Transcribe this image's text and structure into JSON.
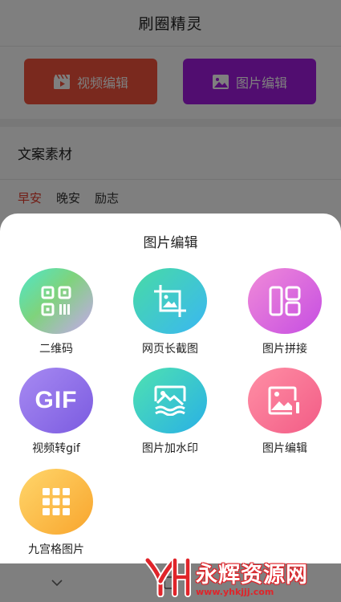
{
  "app": {
    "title": "刷圈精灵",
    "video_button": "视频编辑",
    "image_button": "图片编辑",
    "section_title": "文案素材",
    "tabs": [
      "早安",
      "晚安",
      "励志"
    ]
  },
  "sheet": {
    "title": "图片编辑",
    "tools": [
      {
        "label": "二维码",
        "icon": "qr-code-icon"
      },
      {
        "label": "网页长截图",
        "icon": "crop-image-icon"
      },
      {
        "label": "图片拼接",
        "icon": "collage-icon"
      },
      {
        "label": "视频转gif",
        "icon": "gif-icon",
        "icon_text": "GIF"
      },
      {
        "label": "图片加水印",
        "icon": "watermark-image-icon"
      },
      {
        "label": "图片编辑",
        "icon": "edit-image-icon"
      },
      {
        "label": "九宫格图片",
        "icon": "grid-nine-icon"
      }
    ]
  },
  "watermark": {
    "name": "永辉资源网",
    "url": "www.yhkjjj.com"
  },
  "colors": {
    "video_button": "#f4533d",
    "image_button": "#a21be0",
    "tab_active": "#e53b2a"
  }
}
